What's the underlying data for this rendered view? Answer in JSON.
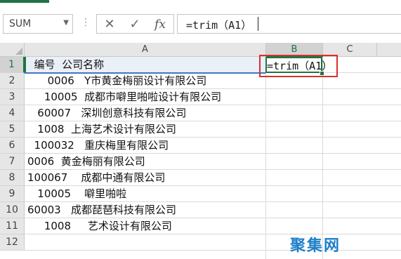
{
  "name_box": {
    "value": "SUM",
    "dropdown_icon": "chevron-down-icon"
  },
  "formula_bar": {
    "cancel_icon": "close-icon",
    "enter_icon": "check-icon",
    "insert_function_label": "fx",
    "formula": "=trim（A1）"
  },
  "columns": [
    "A",
    "B",
    "C"
  ],
  "rows": [
    "1",
    "2",
    "3",
    "4",
    "5",
    "6",
    "7",
    "8",
    "9",
    "10",
    "11",
    "12"
  ],
  "cells": {
    "A": [
      "  编号  公司名称",
      "      0006   Y市黄金梅丽设计有限公司",
      "     10005  成都市噼里啪啦设计有限公司",
      "   60007   深圳创意科技有限公司",
      "   1008  上海艺术设计有限公司",
      "  100032   重庆梅里有限公司",
      "0006  黄金梅丽有限公司",
      "100067    成都中通有限公司",
      "   10005    噼里啪啦",
      "60003   成都琵琶科技有限公司",
      "     1008     艺术设计有限公司",
      ""
    ],
    "B1": "=trim（A1）"
  },
  "watermark": "聚集网",
  "colors": {
    "accent": "#217346",
    "highlight_box": "#d9302c",
    "watermark": "#1e7fc8"
  }
}
